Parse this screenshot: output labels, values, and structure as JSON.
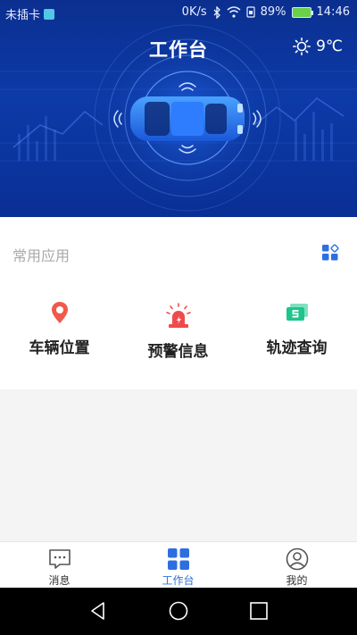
{
  "status_bar": {
    "carrier": "未插卡",
    "speed": "0K/s",
    "battery_pct": "89%",
    "time": "14:46"
  },
  "header": {
    "title": "工作台",
    "weather_icon": "sun-icon",
    "temperature": "9℃"
  },
  "apps": {
    "section_title": "常用应用",
    "grid_icon": "apps-grid-icon",
    "items": [
      {
        "label": "车辆位置",
        "icon": "location-pin-icon",
        "color": "#ef5a4c"
      },
      {
        "label": "预警信息",
        "icon": "alarm-siren-icon",
        "color": "#ef4b4b"
      },
      {
        "label": "轨迹查询",
        "icon": "track-card-icon",
        "color": "#1fc48d"
      }
    ]
  },
  "bottom_nav": {
    "items": [
      {
        "label": "消息",
        "icon": "message-icon",
        "active": false
      },
      {
        "label": "工作台",
        "icon": "workbench-grid-icon",
        "active": true
      },
      {
        "label": "我的",
        "icon": "profile-icon",
        "active": false
      }
    ],
    "active_color": "#2e6fe0"
  },
  "system_nav": {
    "buttons": [
      "back-icon",
      "home-icon",
      "recents-icon"
    ]
  }
}
